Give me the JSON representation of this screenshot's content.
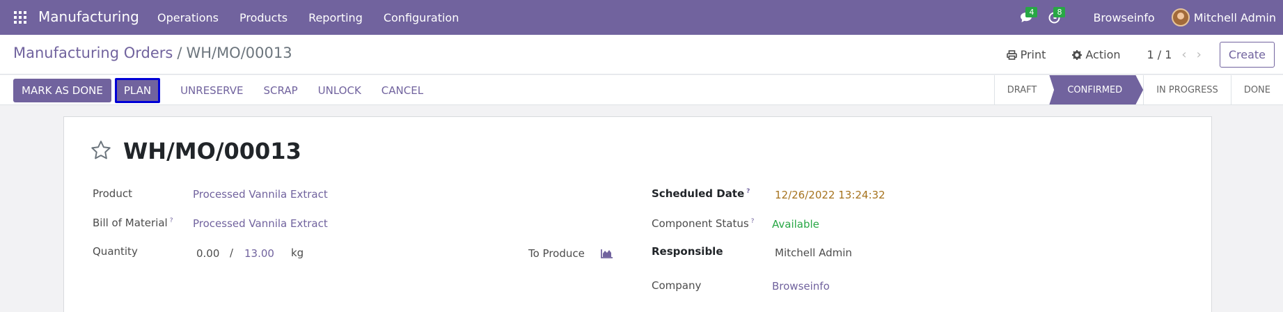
{
  "navbar": {
    "app_name": "Manufacturing",
    "menu": [
      "Operations",
      "Products",
      "Reporting",
      "Configuration"
    ],
    "messages_count": "4",
    "activities_count": "8",
    "company": "Browseinfo",
    "user": "Mitchell Admin"
  },
  "control_panel": {
    "breadcrumb_parent": "Manufacturing Orders",
    "breadcrumb_separator": "/",
    "breadcrumb_current": "WH/MO/00013",
    "print_label": "Print",
    "action_label": "Action",
    "pager": "1 / 1",
    "create_label": "Create"
  },
  "statusbar": {
    "buttons": {
      "mark_as_done": "MARK AS DONE",
      "plan": "PLAN",
      "unreserve": "UNRESERVE",
      "scrap": "SCRAP",
      "unlock": "UNLOCK",
      "cancel": "CANCEL"
    },
    "stages": [
      "DRAFT",
      "CONFIRMED",
      "IN PROGRESS",
      "DONE"
    ],
    "active_stage": "CONFIRMED"
  },
  "form": {
    "title": "WH/MO/00013",
    "product_label": "Product",
    "product_value": "Processed Vannila Extract",
    "bom_label": "Bill of Material",
    "bom_value": "Processed Vannila Extract",
    "quantity_label": "Quantity",
    "qty_produced": "0.00",
    "qty_separator": "/",
    "qty_total": "13.00",
    "qty_uom": "kg",
    "to_produce_label": "To Produce",
    "scheduled_date_label": "Scheduled Date",
    "scheduled_date_value": "12/26/2022 13:24:32",
    "component_status_label": "Component Status",
    "component_status_value": "Available",
    "responsible_label": "Responsible",
    "responsible_value": "Mitchell Admin",
    "company_label": "Company",
    "company_value": "Browseinfo",
    "help_marker": "?"
  },
  "colors": {
    "brand": "#71639e",
    "date": "#a6731e",
    "available": "#28a745",
    "plan_focus_border": "#0000d6"
  }
}
